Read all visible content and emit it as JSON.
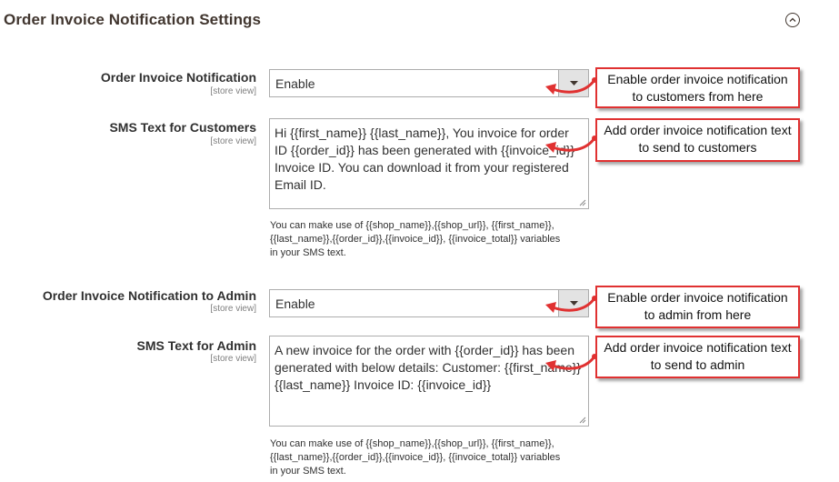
{
  "section": {
    "title": "Order Invoice Notification Settings"
  },
  "fields": {
    "customer_notification": {
      "label": "Order Invoice Notification",
      "scope": "[store view]",
      "value": "Enable"
    },
    "customer_sms": {
      "label": "SMS Text for Customers",
      "scope": "[store view]",
      "text": " Hi {{first_name}} {{last_name}}, You invoice for order ID {{order_id}} has been generated with {{invoice_id}} Invoice ID. You can download it from your registered Email ID.",
      "note": "You can make use of {{shop_name}},{{shop_url}}, {{first_name}},{{last_name}},{{order_id}},{{invoice_id}}, {{invoice_total}} variables in your SMS text."
    },
    "admin_notification": {
      "label": "Order Invoice Notification to Admin",
      "scope": "[store view]",
      "value": "Enable"
    },
    "admin_sms": {
      "label": "SMS Text for Admin",
      "scope": "[store view]",
      "text": "A new invoice for the order with {{order_id}} has been generated with below details: Customer: {{first_name}} {{last_name}} Invoice ID: {{invoice_id}}",
      "note": "You can make use of {{shop_name}},{{shop_url}}, {{first_name}},{{last_name}},{{order_id}},{{invoice_id}}, {{invoice_total}} variables in your SMS text."
    }
  },
  "callouts": {
    "customer_notification": "Enable order invoice notification to customers from here",
    "customer_sms": "Add order invoice notification text to send to customers",
    "admin_notification": "Enable order invoice notification to admin from here",
    "admin_sms": "Add order invoice notification text to send to admin"
  },
  "colors": {
    "callout_border": "#e03131",
    "heading": "#41362f"
  },
  "icons": {
    "collapse": "chevron-up-circle-icon",
    "dropdown": "caret-down-icon"
  }
}
